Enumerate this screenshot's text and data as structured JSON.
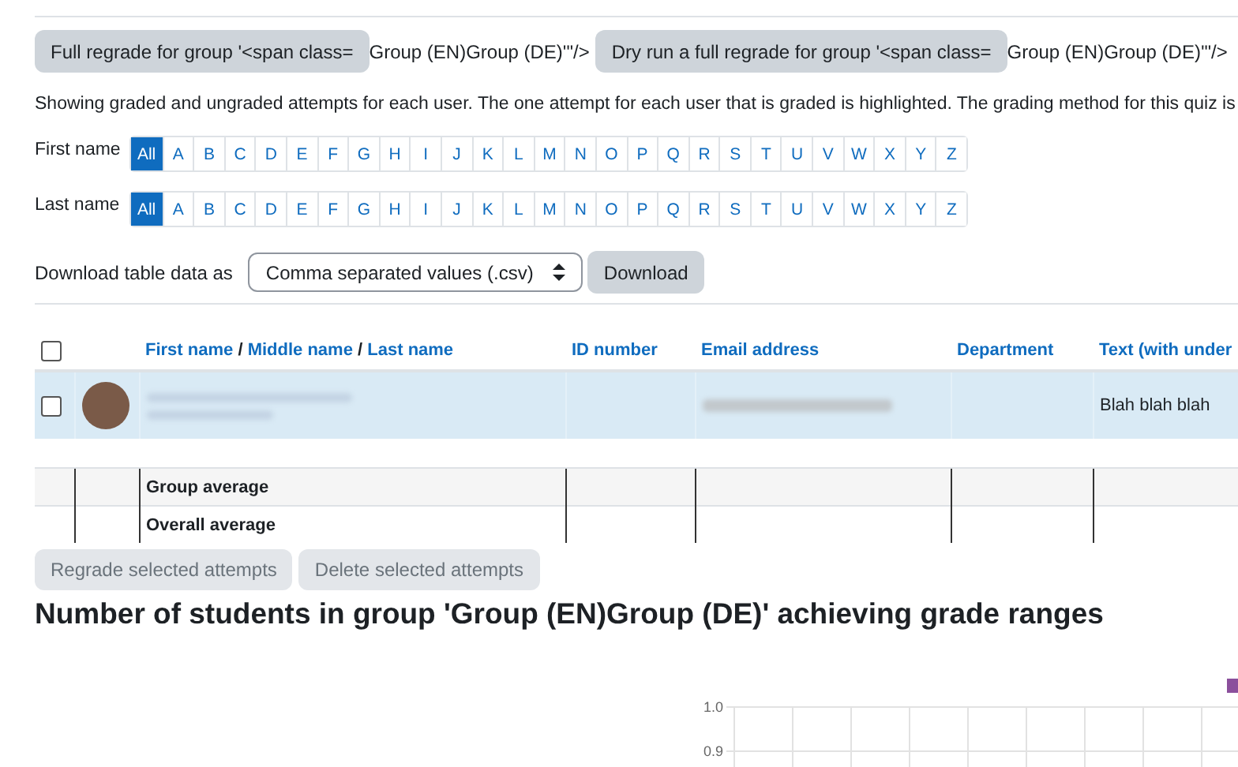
{
  "regrade_buttons": [
    {
      "label": "Full regrade for group '<span class=",
      "trailing_text": "Group (EN)Group (DE)'\"/>"
    },
    {
      "label": "Dry run a full regrade for group '<span class=",
      "trailing_text": "Group (EN)Group (DE)'\"/>"
    }
  ],
  "intro": "Showing graded and ungraded attempts for each user. The one attempt for each user that is graded is highlighted. The grading method for this quiz is",
  "initials_bars": [
    {
      "label": "First name",
      "letters": [
        {
          "label": "All",
          "selected": true
        },
        {
          "label": "A",
          "selected": false
        },
        {
          "label": "B",
          "selected": false
        },
        {
          "label": "C",
          "selected": false
        },
        {
          "label": "D",
          "selected": false
        },
        {
          "label": "E",
          "selected": false
        },
        {
          "label": "F",
          "selected": false
        },
        {
          "label": "G",
          "selected": false
        },
        {
          "label": "H",
          "selected": false
        },
        {
          "label": "I",
          "selected": false
        },
        {
          "label": "J",
          "selected": false
        },
        {
          "label": "K",
          "selected": false
        },
        {
          "label": "L",
          "selected": false
        },
        {
          "label": "M",
          "selected": false
        },
        {
          "label": "N",
          "selected": false
        },
        {
          "label": "O",
          "selected": false
        },
        {
          "label": "P",
          "selected": false
        },
        {
          "label": "Q",
          "selected": false
        },
        {
          "label": "R",
          "selected": false
        },
        {
          "label": "S",
          "selected": false
        },
        {
          "label": "T",
          "selected": false
        },
        {
          "label": "U",
          "selected": false
        },
        {
          "label": "V",
          "selected": false
        },
        {
          "label": "W",
          "selected": false
        },
        {
          "label": "X",
          "selected": false
        },
        {
          "label": "Y",
          "selected": false
        },
        {
          "label": "Z",
          "selected": false
        }
      ]
    },
    {
      "label": "Last name",
      "letters": [
        {
          "label": "All",
          "selected": true
        },
        {
          "label": "A",
          "selected": false
        },
        {
          "label": "B",
          "selected": false
        },
        {
          "label": "C",
          "selected": false
        },
        {
          "label": "D",
          "selected": false
        },
        {
          "label": "E",
          "selected": false
        },
        {
          "label": "F",
          "selected": false
        },
        {
          "label": "G",
          "selected": false
        },
        {
          "label": "H",
          "selected": false
        },
        {
          "label": "I",
          "selected": false
        },
        {
          "label": "J",
          "selected": false
        },
        {
          "label": "K",
          "selected": false
        },
        {
          "label": "L",
          "selected": false
        },
        {
          "label": "M",
          "selected": false
        },
        {
          "label": "N",
          "selected": false
        },
        {
          "label": "O",
          "selected": false
        },
        {
          "label": "P",
          "selected": false
        },
        {
          "label": "Q",
          "selected": false
        },
        {
          "label": "R",
          "selected": false
        },
        {
          "label": "S",
          "selected": false
        },
        {
          "label": "T",
          "selected": false
        },
        {
          "label": "U",
          "selected": false
        },
        {
          "label": "V",
          "selected": false
        },
        {
          "label": "W",
          "selected": false
        },
        {
          "label": "X",
          "selected": false
        },
        {
          "label": "Y",
          "selected": false
        },
        {
          "label": "Z",
          "selected": false
        }
      ]
    }
  ],
  "download": {
    "label": "Download table data as",
    "format": "Comma separated values (.csv)",
    "button": "Download"
  },
  "table": {
    "select_all_checked": false,
    "name_header": [
      "First name",
      "Middle name",
      "Last name"
    ],
    "name_header_separator": "/",
    "columns": [
      "ID number",
      "Email address",
      "Department",
      "Text (with under"
    ],
    "rows": [
      {
        "checked": false,
        "highlighted": true,
        "text_field": "Blah blah blah"
      }
    ],
    "summary_rows": [
      "Group average",
      "Overall average"
    ]
  },
  "actions": [
    "Regrade selected attempts",
    "Delete selected attempts"
  ],
  "chart": {
    "title": "Number of students in group 'Group (EN)Group (DE)' achieving grade ranges",
    "y_tick_labels": [
      "1.0",
      "0.9"
    ]
  }
}
